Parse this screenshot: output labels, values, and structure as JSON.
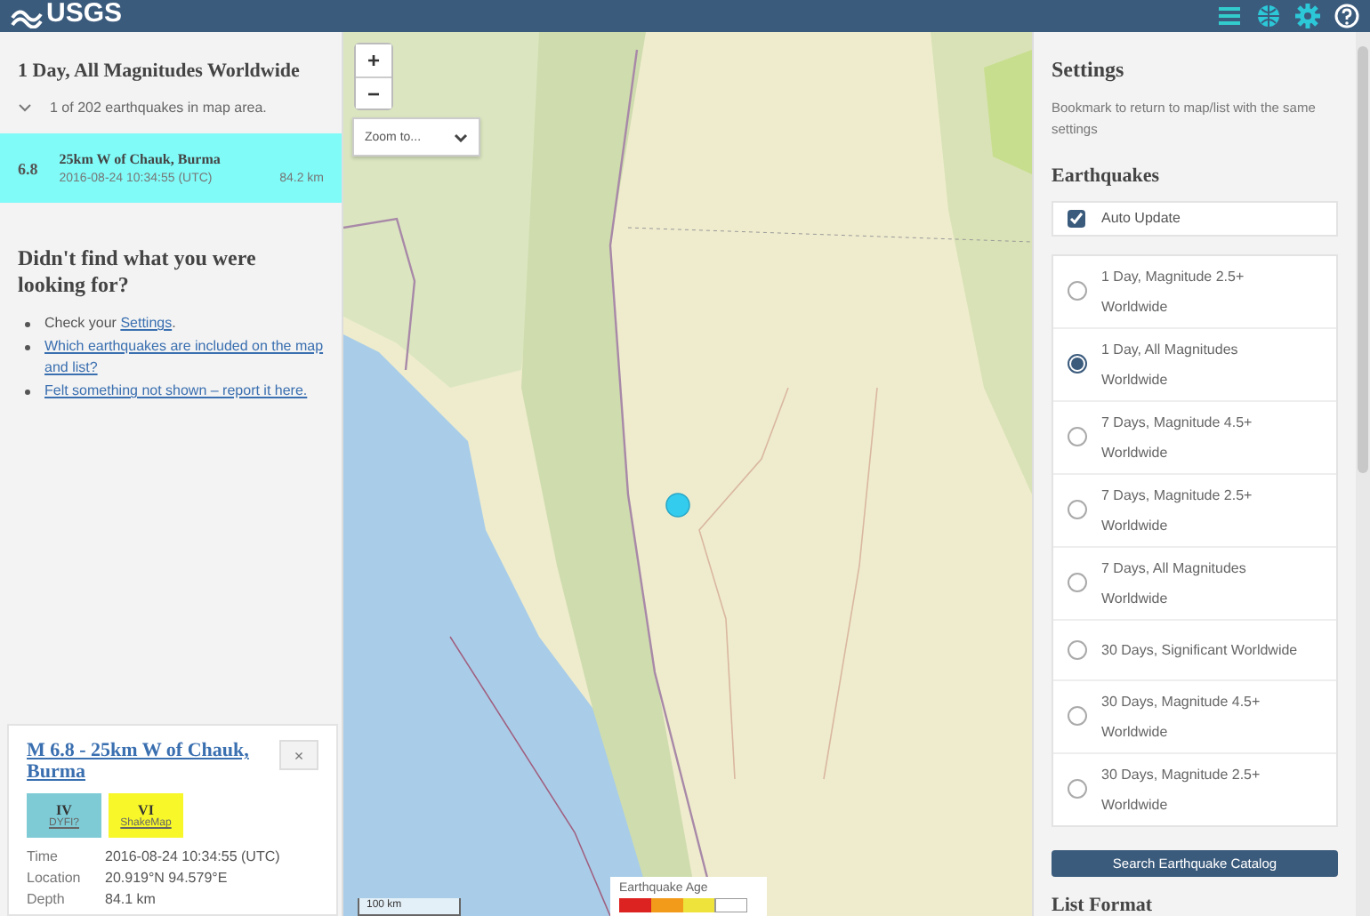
{
  "header": {
    "logo": "USGS"
  },
  "event_list": {
    "title": "1 Day, All Magnitudes Worldwide",
    "count": "1 of 202 earthquakes in map area.",
    "events": [
      {
        "magnitude": "6.8",
        "place": "25km W of Chauk, Burma",
        "time": "2016-08-24 10:34:55 (UTC)",
        "depth": "84.2 km",
        "selected": true
      }
    ],
    "help": {
      "heading": "Didn't find what you were looking for?",
      "items": [
        {
          "prefix": "Check your ",
          "link": "Settings",
          "suffix": "."
        },
        {
          "link": "Which earthquakes are included on the map and list?"
        },
        {
          "link": "Felt something not shown – report it here."
        }
      ]
    }
  },
  "map": {
    "zoom_in": "+",
    "zoom_out": "−",
    "zoom_select": "Zoom to...",
    "scale": "100 km",
    "legend_title": "Earthquake Age"
  },
  "details": {
    "title": "M 6.8 - 25km W of Chauk, Burma",
    "close": "×",
    "badges": [
      {
        "value": "IV",
        "label": "DYFI?",
        "color": "#7ecbd6"
      },
      {
        "value": "VI",
        "label": "ShakeMap",
        "color": "#f7f72a"
      }
    ],
    "fields": [
      {
        "label": "Time",
        "value": "2016-08-24 10:34:55 (UTC)"
      },
      {
        "label": "Location",
        "value": "20.919°N 94.579°E"
      },
      {
        "label": "Depth",
        "value": "84.1 km"
      }
    ]
  },
  "settings": {
    "title": "Settings",
    "description": "Bookmark to return to map/list with the same settings",
    "earthquakes_heading": "Earthquakes",
    "auto_update": {
      "label": "Auto Update",
      "checked": true
    },
    "feeds": [
      {
        "label": "1 Day, Magnitude 2.5+ Worldwide",
        "selected": false
      },
      {
        "label": "1 Day, All Magnitudes Worldwide",
        "selected": true
      },
      {
        "label": "7 Days, Magnitude 4.5+ Worldwide",
        "selected": false
      },
      {
        "label": "7 Days, Magnitude 2.5+ Worldwide",
        "selected": false
      },
      {
        "label": "7 Days, All Magnitudes Worldwide",
        "selected": false
      },
      {
        "label": "30 Days, Significant Worldwide",
        "selected": false
      },
      {
        "label": "30 Days, Magnitude 4.5+ Worldwide",
        "selected": false
      },
      {
        "label": "30 Days, Magnitude 2.5+ Worldwide",
        "selected": false
      }
    ],
    "search_button": "Search Earthquake Catalog",
    "list_format_heading": "List Format"
  }
}
